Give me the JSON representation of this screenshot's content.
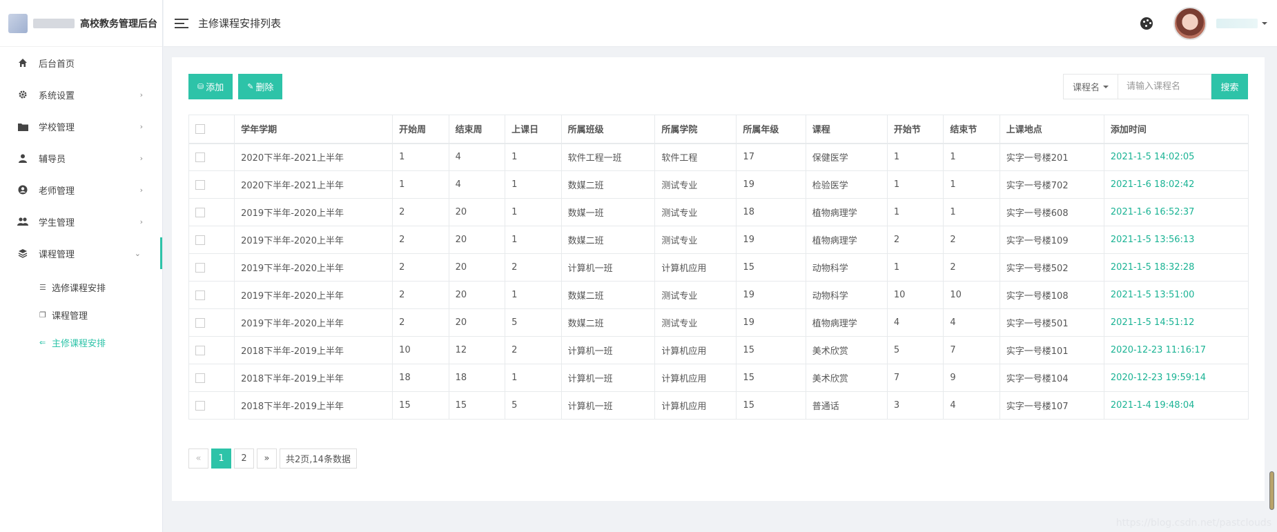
{
  "brand": {
    "title": "高校教务管理后台"
  },
  "sidebar": {
    "items": [
      {
        "label": "后台首页",
        "icon": "home-icon",
        "has_children": false
      },
      {
        "label": "系统设置",
        "icon": "gear-icon",
        "has_children": true
      },
      {
        "label": "学校管理",
        "icon": "folder-icon",
        "has_children": true
      },
      {
        "label": "辅导员",
        "icon": "user-icon",
        "has_children": true
      },
      {
        "label": "老师管理",
        "icon": "user-circle-icon",
        "has_children": true
      },
      {
        "label": "学生管理",
        "icon": "users-icon",
        "has_children": true
      },
      {
        "label": "课程管理",
        "icon": "layers-icon",
        "has_children": true,
        "expanded": true
      }
    ],
    "subitems": [
      {
        "label": "选修课程安排",
        "icon": "list-icon",
        "active": false
      },
      {
        "label": "课程管理",
        "icon": "copy-icon",
        "active": false
      },
      {
        "label": "主修课程安排",
        "icon": "arrow-left-icon",
        "active": true
      }
    ]
  },
  "header": {
    "title": "主修课程安排列表"
  },
  "toolbar": {
    "add_label": "添加",
    "delete_label": "删除"
  },
  "search": {
    "select_label": "课程名",
    "placeholder": "请输入课程名",
    "button_label": "搜索"
  },
  "table": {
    "headers": [
      "学年学期",
      "开始周",
      "结束周",
      "上课日",
      "所属班级",
      "所属学院",
      "所属年级",
      "课程",
      "开始节",
      "结束节",
      "上课地点",
      "添加时间"
    ],
    "rows": [
      [
        "2020下半年-2021上半年",
        "1",
        "4",
        "1",
        "软件工程一班",
        "软件工程",
        "17",
        "保健医学",
        "1",
        "1",
        "实字一号楼201",
        "2021-1-5 14:02:05"
      ],
      [
        "2020下半年-2021上半年",
        "1",
        "4",
        "1",
        "数媒二班",
        "测试专业",
        "19",
        "检验医学",
        "1",
        "1",
        "实字一号楼702",
        "2021-1-6 18:02:42"
      ],
      [
        "2019下半年-2020上半年",
        "2",
        "20",
        "1",
        "数媒一班",
        "测试专业",
        "18",
        "植物病理学",
        "1",
        "1",
        "实字一号楼608",
        "2021-1-6 16:52:37"
      ],
      [
        "2019下半年-2020上半年",
        "2",
        "20",
        "1",
        "数媒二班",
        "测试专业",
        "19",
        "植物病理学",
        "2",
        "2",
        "实字一号楼109",
        "2021-1-5 13:56:13"
      ],
      [
        "2019下半年-2020上半年",
        "2",
        "20",
        "2",
        "计算机一班",
        "计算机应用",
        "15",
        "动物科学",
        "1",
        "2",
        "实字一号楼502",
        "2021-1-5 18:32:28"
      ],
      [
        "2019下半年-2020上半年",
        "2",
        "20",
        "1",
        "数媒二班",
        "测试专业",
        "19",
        "动物科学",
        "10",
        "10",
        "实字一号楼108",
        "2021-1-5 13:51:00"
      ],
      [
        "2019下半年-2020上半年",
        "2",
        "20",
        "5",
        "数媒二班",
        "测试专业",
        "19",
        "植物病理学",
        "4",
        "4",
        "实字一号楼501",
        "2021-1-5 14:51:12"
      ],
      [
        "2018下半年-2019上半年",
        "10",
        "12",
        "2",
        "计算机一班",
        "计算机应用",
        "15",
        "美术欣赏",
        "5",
        "7",
        "实字一号楼101",
        "2020-12-23 11:16:17"
      ],
      [
        "2018下半年-2019上半年",
        "18",
        "18",
        "1",
        "计算机一班",
        "计算机应用",
        "15",
        "美术欣赏",
        "7",
        "9",
        "实字一号楼104",
        "2020-12-23 19:59:14"
      ],
      [
        "2018下半年-2019上半年",
        "15",
        "15",
        "5",
        "计算机一班",
        "计算机应用",
        "15",
        "普通话",
        "3",
        "4",
        "实字一号楼107",
        "2021-1-4 19:48:04"
      ]
    ]
  },
  "pagination": {
    "prev": "«",
    "pages": [
      "1",
      "2"
    ],
    "current": "1",
    "next": "»",
    "info": "共2页,14条数据"
  },
  "watermark": "https://blog.csdn.net/pastclouds",
  "colors": {
    "accent": "#2dc3a8",
    "time_text": "#1ab394"
  }
}
